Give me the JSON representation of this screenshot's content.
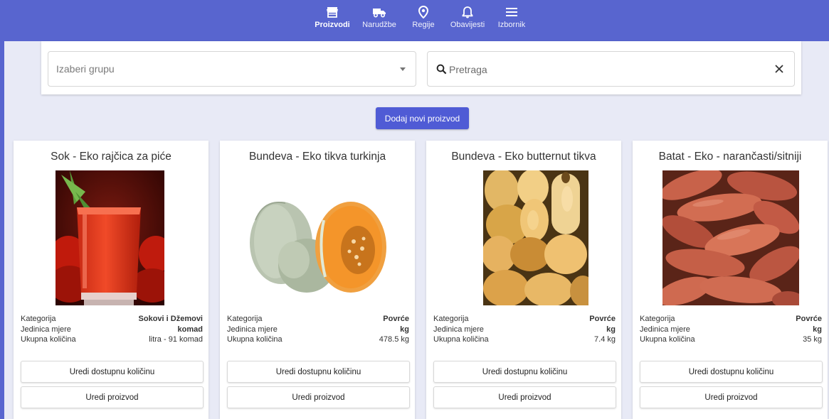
{
  "nav": {
    "tabs": [
      {
        "label": "Proizvodi",
        "icon": "store-icon",
        "active": true
      },
      {
        "label": "Narudžbe",
        "icon": "truck-icon",
        "active": false
      },
      {
        "label": "Regije",
        "icon": "location-pin-icon",
        "active": false
      },
      {
        "label": "Obavijesti",
        "icon": "bell-icon",
        "active": false
      },
      {
        "label": "Izbornik",
        "icon": "menu-icon",
        "active": false
      }
    ],
    "color": "#5865cf"
  },
  "filters": {
    "group_placeholder": "Izaberi grupu",
    "search_placeholder": "Pretraga"
  },
  "add_button_label": "Dodaj novi proizvod",
  "labels": {
    "category": "Kategorija",
    "unit": "Jedinica mjere",
    "total": "Ukupna količina",
    "edit_quantity": "Uredi dostupnu količinu",
    "edit_product": "Uredi proizvod"
  },
  "products": [
    {
      "title": "Sok - Eko rajčica za piće",
      "category": "Sokovi i Džemovi",
      "unit": "komad",
      "total": "litra - 91 komad",
      "image": "tomato-juice-glass"
    },
    {
      "title": "Bundeva - Eko tikva turkinja",
      "category": "Povrće",
      "unit": "kg",
      "total": "478.5 kg",
      "image": "pumpkin-halves"
    },
    {
      "title": "Bundeva - Eko butternut tikva",
      "category": "Povrće",
      "unit": "kg",
      "total": "7.4 kg",
      "image": "butternut-squash-pile"
    },
    {
      "title": "Batat - Eko - narančasti/sitniji",
      "category": "Povrće",
      "unit": "kg",
      "total": "35 kg",
      "image": "sweet-potatoes-pile"
    }
  ]
}
